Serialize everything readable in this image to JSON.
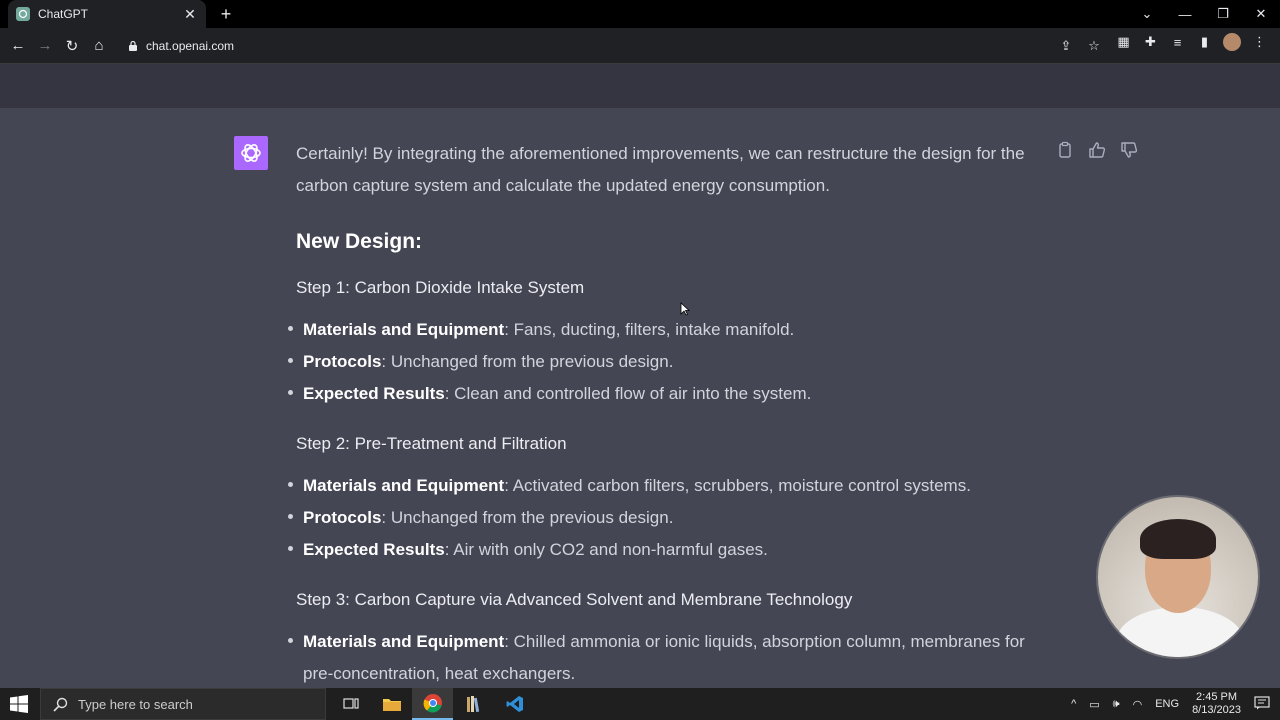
{
  "browser": {
    "tab_title": "ChatGPT",
    "url": "chat.openai.com"
  },
  "message": {
    "intro": "Certainly! By integrating the aforementioned improvements, we can restructure the design for the carbon capture system and calculate the updated energy consumption.",
    "heading": "New Design:",
    "steps": [
      {
        "title": "Step 1: Carbon Dioxide Intake System",
        "bullets": [
          {
            "label": "Materials and Equipment",
            "text": ": Fans, ducting, filters, intake manifold."
          },
          {
            "label": "Protocols",
            "text": ": Unchanged from the previous design."
          },
          {
            "label": "Expected Results",
            "text": ": Clean and controlled flow of air into the system."
          }
        ]
      },
      {
        "title": "Step 2: Pre-Treatment and Filtration",
        "bullets": [
          {
            "label": "Materials and Equipment",
            "text": ": Activated carbon filters, scrubbers, moisture control systems."
          },
          {
            "label": "Protocols",
            "text": ": Unchanged from the previous design."
          },
          {
            "label": "Expected Results",
            "text": ": Air with only CO2 and non-harmful gases."
          }
        ]
      },
      {
        "title": "Step 3: Carbon Capture via Advanced Solvent and Membrane Technology",
        "bullets": [
          {
            "label": "Materials and Equipment",
            "text": ": Chilled ammonia or ionic liquids, absorption column, membranes for pre-concentration, heat exchangers."
          }
        ]
      }
    ]
  },
  "taskbar": {
    "search_placeholder": "Type here to search",
    "language": "ENG",
    "time": "2:45 PM",
    "date": "8/13/2023"
  },
  "colors": {
    "page_bg": "#444654",
    "topbar_bg": "#343541",
    "avatar_bg": "#ab68ff"
  }
}
